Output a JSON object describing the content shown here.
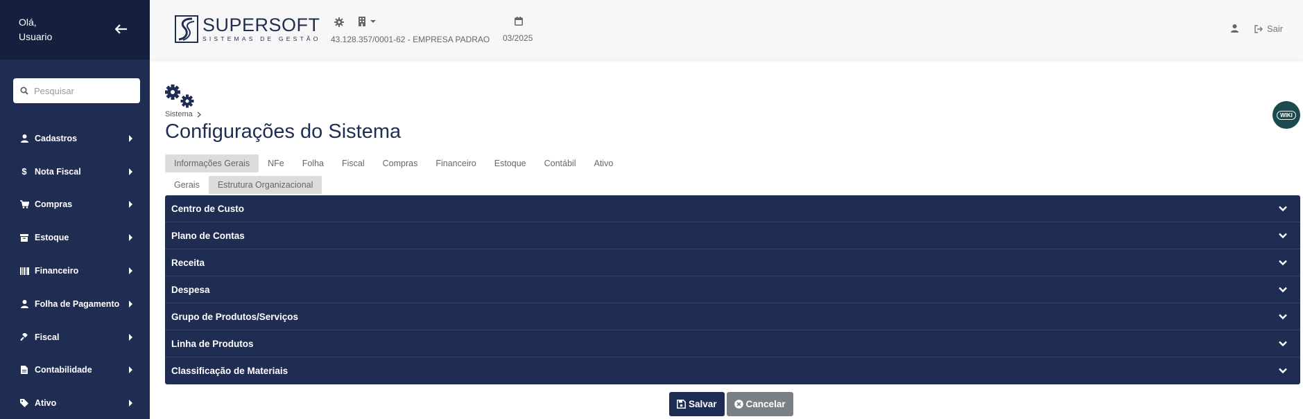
{
  "sidebar": {
    "greeting_line1": "Olá,",
    "greeting_line2": "Usuario",
    "search_placeholder": "Pesquisar",
    "items": [
      {
        "label": "Cadastros",
        "icon": "user-icon"
      },
      {
        "label": "Nota Fiscal",
        "icon": "dollar-icon"
      },
      {
        "label": "Compras",
        "icon": "cart-icon"
      },
      {
        "label": "Estoque",
        "icon": "archive-icon"
      },
      {
        "label": "Financeiro",
        "icon": "barcode-icon"
      },
      {
        "label": "Folha de Pagamento",
        "icon": "user-icon"
      },
      {
        "label": "Fiscal",
        "icon": "gavel-icon"
      },
      {
        "label": "Contabilidade",
        "icon": "file-icon"
      },
      {
        "label": "Ativo",
        "icon": "tag-icon"
      }
    ]
  },
  "header": {
    "logo_title": "SUPERSOFT",
    "logo_subtitle": "SISTEMAS DE GESTÃO",
    "company": "43.128.357/0001-62 - EMPRESA PADRAO",
    "period": "03/2025",
    "logout_label": "Sair"
  },
  "page": {
    "breadcrumb": "Sistema",
    "title": "Configurações do Sistema",
    "wiki_label": "WIKI",
    "tabs": [
      "Informações Gerais",
      "NFe",
      "Folha",
      "Fiscal",
      "Compras",
      "Financeiro",
      "Estoque",
      "Contábil",
      "Ativo"
    ],
    "active_tab": "Informações Gerais",
    "subtabs": [
      "Gerais",
      "Estrutura Organizacional"
    ],
    "active_subtab": "Estrutura Organizacional",
    "sections": [
      "Centro de Custo",
      "Plano de Contas",
      "Receita",
      "Despesa",
      "Grupo de Produtos/Serviços",
      "Linha de Produtos",
      "Classificação de Materiais"
    ],
    "save_label": "Salvar",
    "cancel_label": "Cancelar"
  },
  "colors": {
    "sidebar_bg": "#1f2d52",
    "sidebar_head_bg": "#15203f",
    "accent": "#1f2d52",
    "cancel_button": "#7a7f85",
    "wiki_bg": "#1a4a4f"
  }
}
